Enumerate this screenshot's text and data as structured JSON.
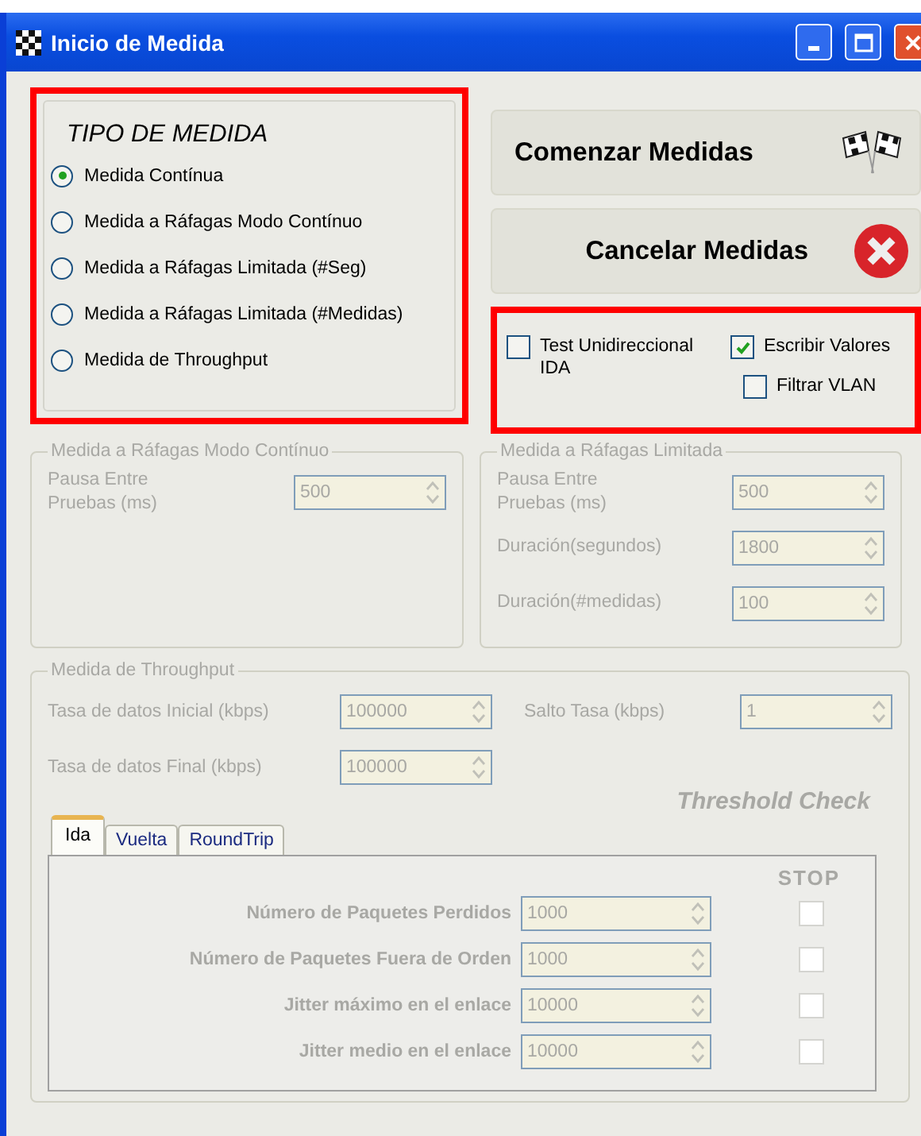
{
  "window": {
    "title": "Inicio de Medida"
  },
  "tipo_medida": {
    "title": "TIPO DE MEDIDA",
    "options": [
      {
        "label": "Medida Contínua",
        "selected": true
      },
      {
        "label": "Medida a Ráfagas Modo Contínuo",
        "selected": false
      },
      {
        "label": "Medida a Ráfagas Limitada  (#Seg)",
        "selected": false
      },
      {
        "label": "Medida a Ráfagas Limitada (#Medidas)",
        "selected": false
      },
      {
        "label": "Medida de Throughput",
        "selected": false
      }
    ]
  },
  "buttons": [
    {
      "label": "Comenzar Medidas",
      "kind": "start"
    },
    {
      "label": "Cancelar Medidas",
      "kind": "cancel"
    }
  ],
  "options": [
    {
      "label": "Test Unidireccional IDA",
      "checked": false
    },
    {
      "label": "Escribir Valores",
      "checked": true
    },
    {
      "label": "Filtrar VLAN",
      "checked": false
    }
  ],
  "rafagas_continuo": {
    "title": "Medida a Ráfagas Modo Contínuo",
    "disabled": true,
    "fields": [
      {
        "label": "Pausa Entre Pruebas (ms)",
        "value": "500"
      }
    ]
  },
  "rafagas_limitada": {
    "title": "Medida a Ráfagas Limitada",
    "disabled": true,
    "fields": [
      {
        "label": "Pausa Entre Pruebas (ms)",
        "value": "500"
      },
      {
        "label": "Duración(segundos)",
        "value": "1800"
      },
      {
        "label": "Duración(#medidas)",
        "value": "100"
      }
    ]
  },
  "throughput": {
    "title": "Medida de Throughput",
    "disabled": true,
    "fields": [
      {
        "label": "Tasa de datos Inicial (kbps)",
        "value": "100000"
      },
      {
        "label": "Salto Tasa (kbps)",
        "value": "1"
      },
      {
        "label": "Tasa de datos Final (kbps)",
        "value": "100000"
      }
    ],
    "threshold_title": "Threshold Check",
    "tabs": [
      {
        "label": "Ida",
        "selected": true
      },
      {
        "label": "Vuelta",
        "selected": false
      },
      {
        "label": "RoundTrip",
        "selected": false
      }
    ],
    "stop_header": "STOP",
    "thresholds": [
      {
        "label": "Número de Paquetes Perdidos",
        "value": "1000",
        "checked": false
      },
      {
        "label": "Número de Paquetes Fuera de Orden",
        "value": "1000",
        "checked": false
      },
      {
        "label": "Jitter máximo en el enlace",
        "value": "10000",
        "checked": false
      },
      {
        "label": "Jitter medio en el enlace",
        "value": "10000",
        "checked": false
      }
    ]
  }
}
